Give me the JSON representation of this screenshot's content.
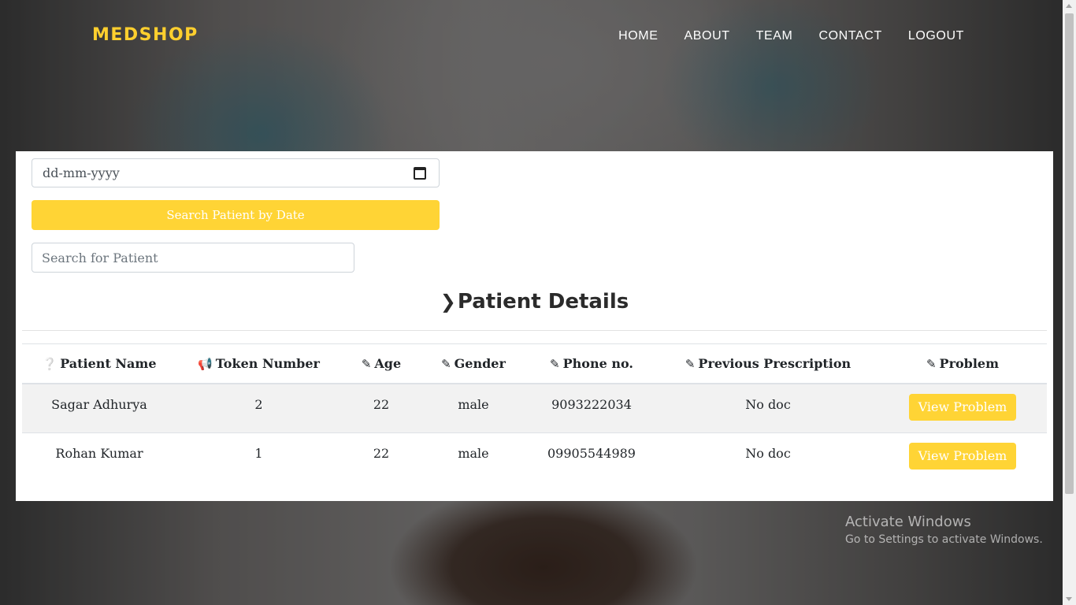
{
  "navbar": {
    "brand": "MEDSHOP",
    "links": [
      "HOME",
      "ABOUT",
      "TEAM",
      "CONTACT",
      "LOGOUT"
    ]
  },
  "search": {
    "date_placeholder": "dd-mm-yyyy",
    "date_button_label": "Search Patient by Date",
    "patient_placeholder": "Search for Patient"
  },
  "section_title": "Patient Details",
  "table": {
    "headers": [
      "Patient Name",
      "Token Number",
      "Age",
      "Gender",
      "Phone no.",
      "Previous Prescription",
      "Problem"
    ],
    "header_icons": [
      "question-circle-icon",
      "megaphone-icon",
      "edit-icon",
      "edit-icon",
      "edit-icon",
      "edit-icon",
      "edit-icon"
    ],
    "rows": [
      {
        "name": "Sagar Adhurya",
        "token": "2",
        "age": "22",
        "gender": "male",
        "phone": "9093222034",
        "prescription": "No doc",
        "action": "View Problem"
      },
      {
        "name": "Rohan Kumar",
        "token": "1",
        "age": "22",
        "gender": "male",
        "phone": "09905544989",
        "prescription": "No doc",
        "action": "View Problem"
      }
    ]
  },
  "watermark": {
    "title": "Activate Windows",
    "subtitle": "Go to Settings to activate Windows."
  },
  "colors": {
    "accent": "#ffd435",
    "brand": "#ffcf2e"
  }
}
